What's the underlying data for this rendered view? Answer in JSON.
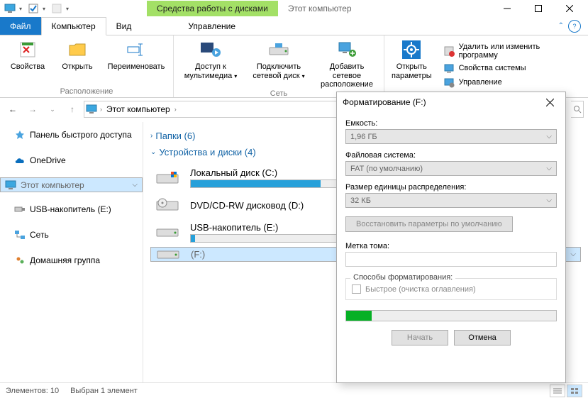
{
  "titlebar": {
    "context_tab": "Средства работы с дисками",
    "context_title": "Этот компьютер"
  },
  "tabs": {
    "file": "Файл",
    "computer": "Компьютер",
    "view": "Вид",
    "manage": "Управление"
  },
  "ribbon": {
    "properties": "Свойства",
    "open": "Открыть",
    "rename": "Переименовать",
    "group_location": "Расположение",
    "media": "Доступ к\nмультимедиа",
    "netdrive": "Подключить\nсетевой диск",
    "addnet": "Добавить сетевое\nрасположение",
    "group_net": "Сеть",
    "open_params": "Открыть\nпараметры",
    "sys_uninstall": "Удалить или изменить программу",
    "sys_props": "Свойства системы",
    "sys_manage": "Управление"
  },
  "address": {
    "crumb": "Этот компьютер"
  },
  "sidebar": {
    "quick": "Панель быстрого доступа",
    "onedrive": "OneDrive",
    "thispc": "Этот компьютер",
    "usb": "USB-накопитель (E:)",
    "network": "Сеть",
    "homegroup": "Домашняя группа"
  },
  "content": {
    "folders_hdr": "Папки (6)",
    "devices_hdr": "Устройства и диски (4)",
    "drive_c": "Локальный диск (C:)",
    "drive_d": "DVD/CD-RW дисковод (D:)",
    "drive_e": "USB-накопитель (E:)",
    "drive_f": "(F:)"
  },
  "status": {
    "elements": "Элементов: 10",
    "selected": "Выбран 1 элемент"
  },
  "dialog": {
    "title": "Форматирование  (F:)",
    "capacity_lbl": "Емкость:",
    "capacity_val": "1,96 ГБ",
    "fs_lbl": "Файловая система:",
    "fs_val": "FAT (по умолчанию)",
    "alloc_lbl": "Размер единицы распределения:",
    "alloc_val": "32 КБ",
    "restore_btn": "Восстановить параметры по умолчанию",
    "label_lbl": "Метка тома:",
    "methods_lbl": "Способы форматирования:",
    "quick": "Быстрое (очистка оглавления)",
    "start": "Начать",
    "cancel": "Отмена",
    "progress_pct": 12
  }
}
